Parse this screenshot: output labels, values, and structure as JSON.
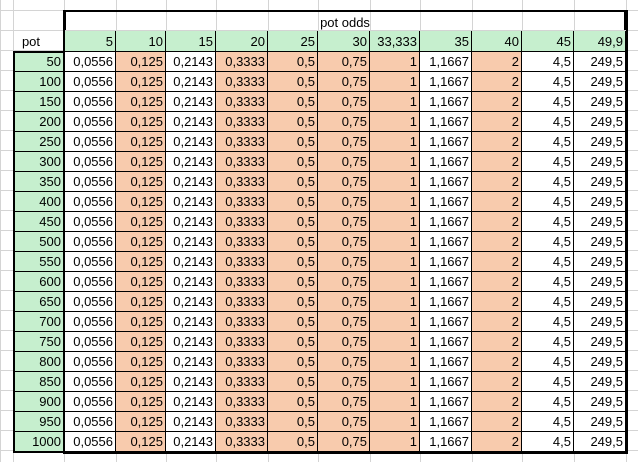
{
  "sheet": {
    "title": "pot odds",
    "row_header_label": "pot",
    "columns": [
      "5",
      "10",
      "15",
      "20",
      "25",
      "30",
      "33,333",
      "35",
      "40",
      "45",
      "49,9"
    ],
    "column_colors": [
      "green",
      "green",
      "green",
      "green",
      "green",
      "green",
      "green",
      "green",
      "green",
      "green",
      "green"
    ],
    "value_colors": [
      "white",
      "orange",
      "white",
      "orange",
      "orange",
      "orange",
      "orange",
      "white",
      "orange",
      "white",
      "white"
    ],
    "row_values": [
      "0,0556",
      "0,125",
      "0,2143",
      "0,3333",
      "0,5",
      "0,75",
      "1",
      "1,1667",
      "2",
      "4,5",
      "249,5"
    ],
    "rows": [
      "50",
      "100",
      "150",
      "200",
      "250",
      "300",
      "350",
      "400",
      "450",
      "500",
      "550",
      "600",
      "650",
      "700",
      "750",
      "800",
      "850",
      "900",
      "950",
      "1000"
    ]
  }
}
